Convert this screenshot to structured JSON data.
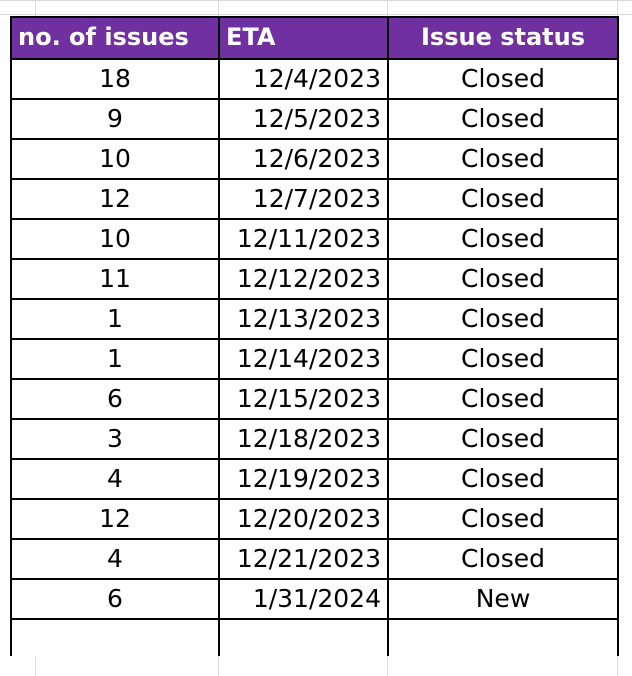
{
  "table": {
    "name": "issue-tracking-table",
    "accent_color": "#7030A0",
    "header_text_color": "#FFFFFF",
    "grid_color": "#000000",
    "columns": [
      {
        "key": "count",
        "label": "no. of issues",
        "align": "left"
      },
      {
        "key": "eta",
        "label": "ETA",
        "align": "left"
      },
      {
        "key": "status",
        "label": "Issue status",
        "align": "center"
      }
    ],
    "rows": [
      {
        "count": "18",
        "eta": "12/4/2023",
        "status": "Closed"
      },
      {
        "count": "9",
        "eta": "12/5/2023",
        "status": "Closed"
      },
      {
        "count": "10",
        "eta": "12/6/2023",
        "status": "Closed"
      },
      {
        "count": "12",
        "eta": "12/7/2023",
        "status": "Closed"
      },
      {
        "count": "10",
        "eta": "12/11/2023",
        "status": "Closed"
      },
      {
        "count": "11",
        "eta": "12/12/2023",
        "status": "Closed"
      },
      {
        "count": "1",
        "eta": "12/13/2023",
        "status": "Closed"
      },
      {
        "count": "1",
        "eta": "12/14/2023",
        "status": "Closed"
      },
      {
        "count": "6",
        "eta": "12/15/2023",
        "status": "Closed"
      },
      {
        "count": "3",
        "eta": "12/18/2023",
        "status": "Closed"
      },
      {
        "count": "4",
        "eta": "12/19/2023",
        "status": "Closed"
      },
      {
        "count": "12",
        "eta": "12/20/2023",
        "status": "Closed"
      },
      {
        "count": "4",
        "eta": "12/21/2023",
        "status": "Closed"
      },
      {
        "count": "6",
        "eta": "1/31/2024",
        "status": "New"
      }
    ],
    "empty_row": {
      "count": "",
      "eta": "",
      "status": ""
    }
  }
}
